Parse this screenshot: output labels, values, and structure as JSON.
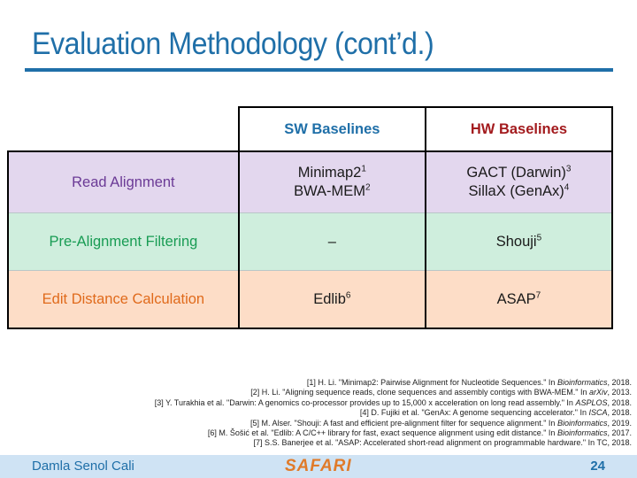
{
  "title": "Evaluation Methodology (cont’d.)",
  "table": {
    "headers": [
      "",
      "SW Baselines",
      "HW Baselines"
    ],
    "rows": [
      {
        "label": "Read Alignment",
        "sw": [
          {
            "text": "Minimap2",
            "ref": "1"
          },
          {
            "text": "BWA-MEM",
            "ref": "2"
          }
        ],
        "hw": [
          {
            "text": "GACT (Darwin)",
            "ref": "3"
          },
          {
            "text": "SillaX (GenAx)",
            "ref": "4"
          }
        ]
      },
      {
        "label": "Pre-Alignment Filtering",
        "sw": [
          {
            "text": "–",
            "ref": ""
          }
        ],
        "hw": [
          {
            "text": "Shouji",
            "ref": "5"
          }
        ]
      },
      {
        "label": "Edit Distance Calculation",
        "sw": [
          {
            "text": "Edlib",
            "ref": "6"
          }
        ],
        "hw": [
          {
            "text": "ASAP",
            "ref": "7"
          }
        ]
      }
    ]
  },
  "references": [
    {
      "pre": "[1] H. Li. \"Minimap2: Pairwise Alignment for Nucleotide Sequences.\" In ",
      "venue": "Bioinformatics",
      "post": ", 2018."
    },
    {
      "pre": "[2] H. Li. \"Aligning sequence reads, clone sequences and assembly contigs with BWA-MEM.\" In ",
      "venue": "arXiv",
      "post": ", 2013."
    },
    {
      "pre": "[3] Y. Turakhia et al. \"Darwin: A genomics co-processor provides up to 15,000 x acceleration on long read assembly.\" In ",
      "venue": "ASPLOS",
      "post": ", 2018."
    },
    {
      "pre": "[4] D. Fujiki et al. \"GenAx: A genome sequencing accelerator.\" In ",
      "venue": "ISCA",
      "post": ", 2018."
    },
    {
      "pre": "[5] M. Alser. \"Shouji: A fast and efficient pre-alignment filter for sequence alignment.\" In ",
      "venue": "Bioinformatics",
      "post": ", 2019."
    },
    {
      "pre": "[6] M. Šošić et al. \"Edlib: A C/C++ library for fast, exact sequence alignment using edit distance.\" In ",
      "venue": "Bioinformatics",
      "post": ", 2017."
    },
    {
      "pre": "[7] S.S. Banerjee et al. \"ASAP: Accelerated short-read alignment on programmable hardware.\" In TC",
      "venue": "",
      "post": ", 2018."
    }
  ],
  "footer": {
    "author": "Damla Senol Cali",
    "brand": "SAFARI",
    "page": "24"
  },
  "colors": {
    "title": "#1f6fa8",
    "sw_header": "#1f6fa8",
    "hw_header": "#a31b1e",
    "read_alignment": "#6b3a96",
    "pre_alignment": "#199c54",
    "edit_distance": "#e06a1b",
    "footer_bg": "#cfe3f4",
    "brand": "#e07b2a"
  }
}
